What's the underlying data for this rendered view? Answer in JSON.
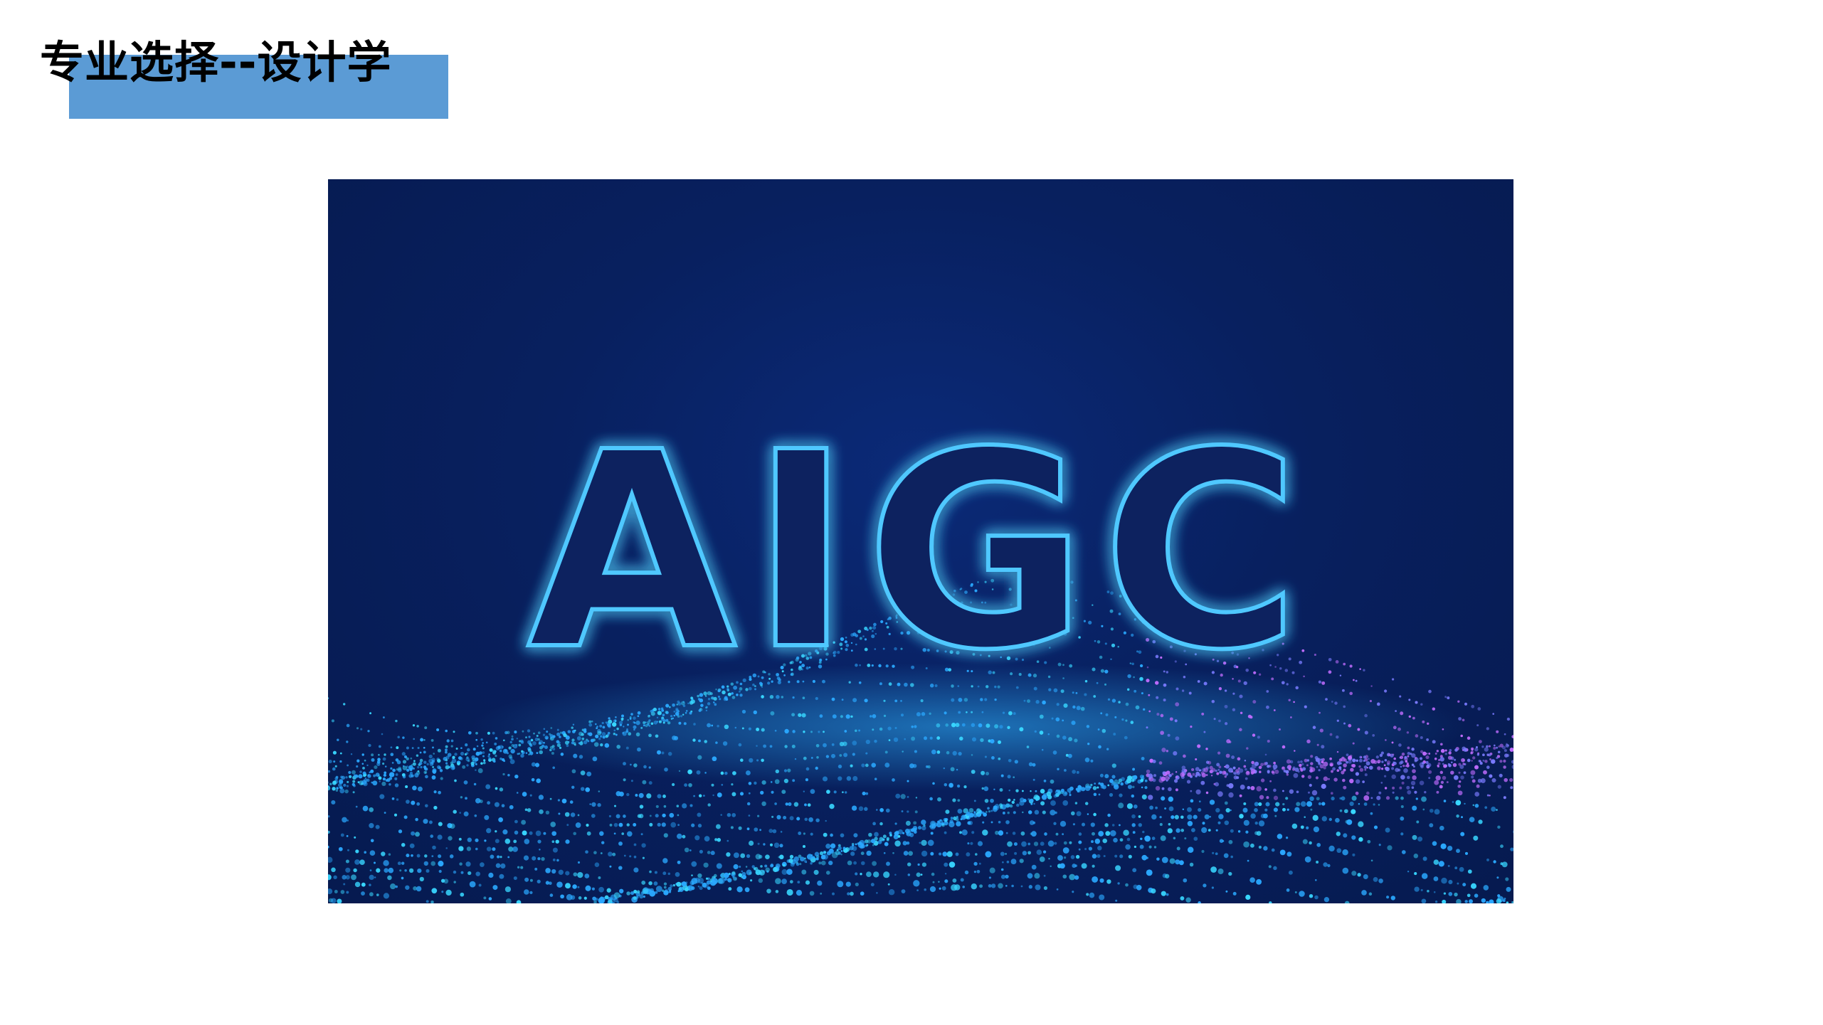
{
  "slide": {
    "title": "专业选择--设计学",
    "accent_color": "#5b9bd5"
  },
  "hero_image": {
    "wordmark": "AIGC",
    "background_color": "#08205f",
    "glow_color": "#29b6ff",
    "particle_colors": [
      "#2aa8ff",
      "#38d6ff",
      "#7a7bff",
      "#c06cff"
    ]
  }
}
